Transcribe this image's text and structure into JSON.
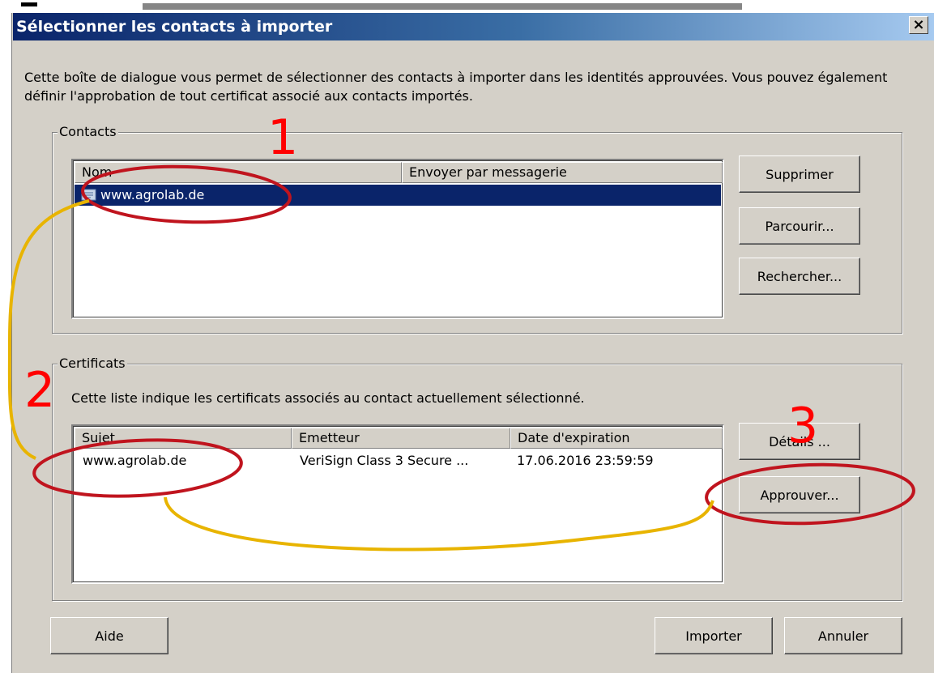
{
  "dialog": {
    "title": "Sélectionner les contacts à importer",
    "close_glyph": "×",
    "intro_text": "Cette boîte de dialogue vous permet de sélectionner des contacts à importer dans les identités approuvées. Vous pouvez également définir l'approbation de tout certificat associé aux contacts importés."
  },
  "contacts": {
    "group_title": "Contacts",
    "columns": [
      "Nom",
      "Envoyer par messagerie"
    ],
    "rows": [
      {
        "name": "www.agrolab.de",
        "email": "",
        "icon": "contact-card-icon"
      }
    ],
    "buttons": {
      "remove": "Supprimer",
      "browse": "Parcourir...",
      "search": "Rechercher..."
    }
  },
  "certificates": {
    "group_title": "Certificats",
    "description": "Cette liste indique les certificats associés au contact actuellement sélectionné.",
    "columns": [
      "Sujet",
      "Emetteur",
      "Date d'expiration"
    ],
    "rows": [
      {
        "subject": "www.agrolab.de",
        "issuer": "VeriSign Class 3 Secure ...",
        "expiration": "17.06.2016 23:59:59"
      }
    ],
    "buttons": {
      "details": "Détails ...",
      "approve": "Approuver..."
    }
  },
  "footer": {
    "help": "Aide",
    "import": "Importer",
    "cancel": "Annuler"
  },
  "annotations": {
    "step1": "1",
    "step2": "2",
    "step3": "3",
    "colors": {
      "circle": "#c0141e",
      "connector": "#e8b400",
      "number": "#ff0000"
    }
  },
  "colors": {
    "dialog_bg": "#d4d0c8",
    "selection_bg": "#0a246a",
    "title_gradient_start": "#0a246a"
  }
}
